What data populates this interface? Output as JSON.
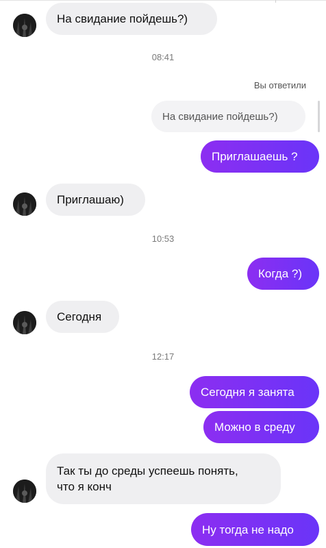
{
  "messages": {
    "m1": "На свидание пойдешь?)",
    "t1": "08:41",
    "reply_label": "Вы ответили",
    "quoted": "На свидание пойдешь?)",
    "m2": "Приглашаешь ?",
    "m3": "Приглашаю)",
    "t2": "10:53",
    "m4": "Когда ?)",
    "m5": "Сегодня",
    "t3": "12:17",
    "m6": "Сегодня я занята",
    "m7": "Можно в среду",
    "m8": "Так ты до среды успеешь понять,\nчто я конч",
    "m9": "Ну тогда не надо"
  },
  "colors": {
    "incoming_bubble": "#efeff1",
    "outgoing_bubble_start": "#8c2ef1",
    "outgoing_bubble_end": "#6a34f8",
    "timestamp": "#7a7a7a"
  },
  "icons": {
    "avatar": "contact-avatar-photo"
  }
}
